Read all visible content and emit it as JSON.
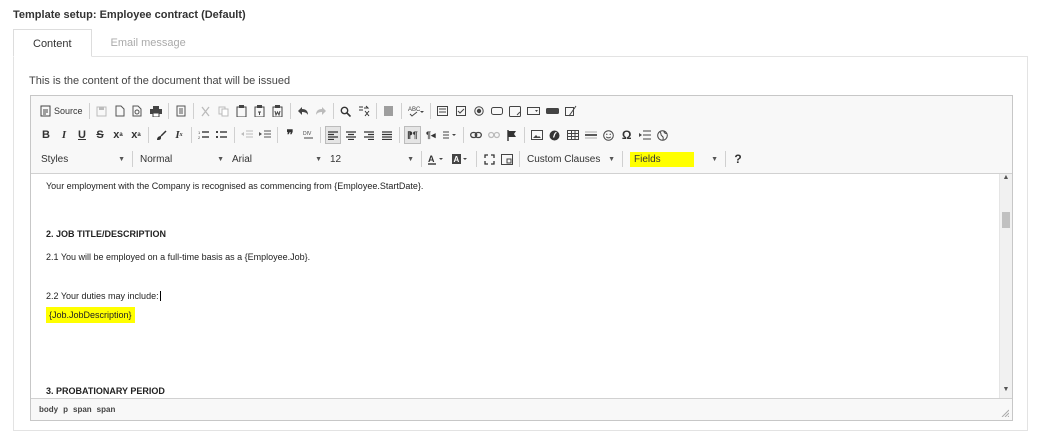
{
  "header": {
    "title": "Template setup: Employee contract (Default)"
  },
  "tabs": [
    {
      "label": "Content",
      "active": true
    },
    {
      "label": "Email message",
      "active": false
    }
  ],
  "content": {
    "description": "This is the content of the document that will be issued"
  },
  "toolbar": {
    "source_label": "Source",
    "styles_combo": "Styles",
    "format_combo": "Normal",
    "font_combo": "Arial",
    "size_combo": "12",
    "custom_clauses_combo": "Custom Clauses",
    "fields_combo": "Fields",
    "help_label": "?",
    "highlight_color": "#ffff00"
  },
  "document": {
    "p1": "Your employment with the Company is recognised as commencing from {Employee.StartDate}.",
    "h2": "2. JOB TITLE/DESCRIPTION",
    "p2_1": "2.1 You will be employed on a full-time basis as a {Employee.Job}.",
    "p2_2": "2.2 Your duties may include:",
    "field": "{Job.JobDescription}",
    "h3": "3. PROBATIONARY PERIOD"
  },
  "statusbar": {
    "path": [
      "body",
      "p",
      "span",
      "span"
    ]
  }
}
